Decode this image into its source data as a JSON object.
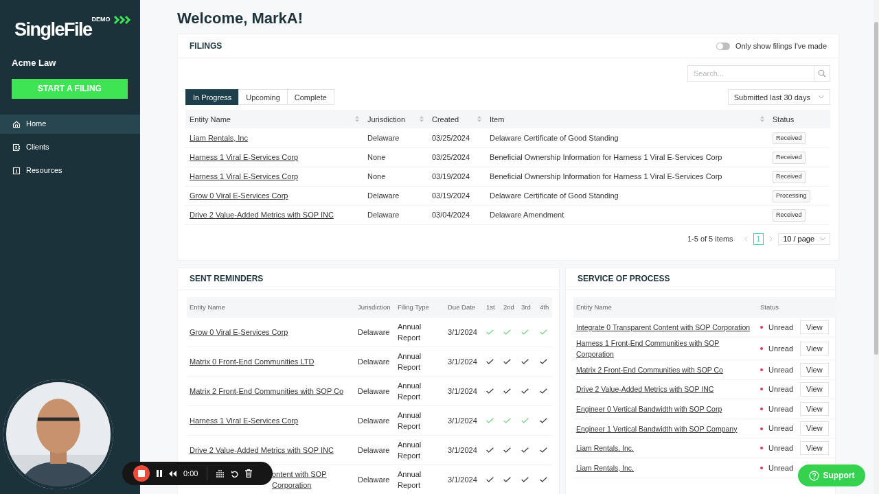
{
  "sidebar": {
    "logo": "SingleFile",
    "logo_badge": "DEMO",
    "org": "Acme Law",
    "cta": "START A FILING",
    "items": [
      {
        "label": "Home",
        "selected": true
      },
      {
        "label": "Clients",
        "selected": false
      },
      {
        "label": "Resources",
        "selected": false
      }
    ]
  },
  "welcome": "Welcome, MarkA!",
  "filings": {
    "title": "FILINGS",
    "toggle": {
      "label": "Only show filings I've made",
      "on": false
    },
    "search": {
      "placeholder": "Search..."
    },
    "tabs": [
      {
        "label": "In Progress",
        "selected": true
      },
      {
        "label": "Upcoming",
        "selected": false
      },
      {
        "label": "Complete",
        "selected": false
      }
    ],
    "range": "Submitted last 30 days",
    "columns": [
      {
        "label": "Entity Name",
        "sortable": true
      },
      {
        "label": "Jurisdiction",
        "sortable": true
      },
      {
        "label": "Created",
        "sortable": true
      },
      {
        "label": "Item",
        "sortable": true
      },
      {
        "label": "Status",
        "sortable": false
      }
    ],
    "rows": [
      {
        "entity": "Liam Rentals, Inc",
        "jurisdiction": "Delaware",
        "created": "03/25/2024",
        "item": "Delaware Certificate of Good Standing",
        "status": "Received"
      },
      {
        "entity": "Harness 1 Viral E-Services Corp",
        "jurisdiction": "None",
        "created": "03/25/2024",
        "item": "Beneficial Ownership Information for Harness 1 Viral E-Services Corp",
        "status": "Received"
      },
      {
        "entity": "Harness 1 Viral E-Services Corp",
        "jurisdiction": "None",
        "created": "03/19/2024",
        "item": "Beneficial Ownership Information for Harness 1 Viral E-Services Corp",
        "status": "Received"
      },
      {
        "entity": "Grow 0 Viral E-Services Corp",
        "jurisdiction": "Delaware",
        "created": "03/19/2024",
        "item": "Delaware Certificate of Good Standing",
        "status": "Processing"
      },
      {
        "entity": "Drive 2 Value-Added Metrics with SOP INC",
        "jurisdiction": "Delaware",
        "created": "03/04/2024",
        "item": "Delaware Amendment",
        "status": "Received"
      }
    ],
    "summary": "1-5 of 5 items",
    "page": "1",
    "page_size": "10 / page"
  },
  "reminders": {
    "title": "SENT REMINDERS",
    "columns": [
      "Entity Name",
      "Jurisdiction",
      "Filing Type",
      "Due Date",
      "1st",
      "2nd",
      "3rd",
      "4th"
    ],
    "rows": [
      {
        "entity": "Grow 0 Viral E-Services Corp",
        "jurisdiction": "Delaware",
        "filing_type": "Annual Report",
        "due": "3/1/2024",
        "sent": [
          true,
          true,
          true,
          true
        ]
      },
      {
        "entity": "Matrix 0 Front-End Communities LTD",
        "jurisdiction": "Delaware",
        "filing_type": "Annual Report",
        "due": "3/1/2024",
        "sent": [
          false,
          false,
          false,
          false
        ]
      },
      {
        "entity": "Matrix 2 Front-End Communities with SOP Co",
        "jurisdiction": "Delaware",
        "filing_type": "Annual Report",
        "due": "3/1/2024",
        "sent": [
          false,
          false,
          false,
          false
        ]
      },
      {
        "entity": "Harness 1 Viral E-Services Corp",
        "jurisdiction": "Delaware",
        "filing_type": "Annual Report",
        "due": "3/1/2024",
        "sent": [
          true,
          true,
          true,
          false
        ]
      },
      {
        "entity": "Drive 2 Value-Added Metrics with SOP INC",
        "jurisdiction": "Delaware",
        "filing_type": "Annual Report",
        "due": "3/1/2024",
        "sent": [
          false,
          false,
          false,
          false
        ]
      },
      {
        "entity": "ontent with SOP Corporation",
        "kind": "covered",
        "jurisdiction": "Delaware",
        "filing_type": "Annual Report",
        "due": "3/1/2024",
        "sent": [
          false,
          false,
          false,
          false
        ]
      }
    ]
  },
  "sop": {
    "title": "SERVICE OF PROCESS",
    "columns": [
      "Entity Name",
      "Status"
    ],
    "rows": [
      {
        "entity": "Integrate 0 Transparent Content with SOP Corporation",
        "status": "Unread",
        "action": "View"
      },
      {
        "entity": "Harness 1 Front-End Communities with SOP Corporation",
        "status": "Unread",
        "action": "View"
      },
      {
        "entity": "Matrix 2 Front-End Communities with SOP Co",
        "status": "Unread",
        "action": "View"
      },
      {
        "entity": "Drive 2 Value-Added Metrics with SOP INC",
        "status": "Unread",
        "action": "View"
      },
      {
        "entity": "Engineer 0 Vertical Bandwidth with SOP Corp",
        "status": "Unread",
        "action": "View"
      },
      {
        "entity": "Engineer 1 Vertical Bandwidth with SOP Company",
        "status": "Unread",
        "action": "View"
      },
      {
        "entity": "Liam Rentals, Inc.",
        "status": "Unread",
        "action": "View"
      },
      {
        "entity": "Liam Rentals, Inc.",
        "status": "Unread"
      }
    ]
  },
  "recorder": {
    "time": "0:00"
  },
  "support": "Support"
}
